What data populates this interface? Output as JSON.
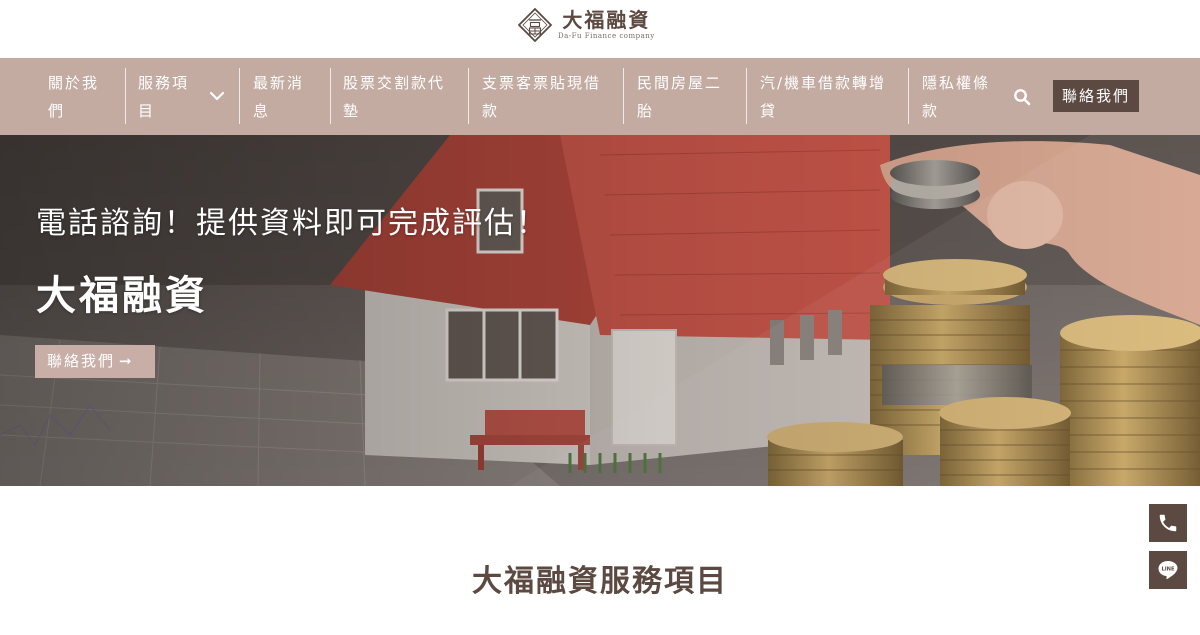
{
  "logo": {
    "name": "大福融資",
    "subtitle": "Da-Fu Finance company"
  },
  "nav": {
    "items": [
      {
        "label_line1": "關於我",
        "label_line2": "們"
      },
      {
        "label_line1": "服務項",
        "label_line2": "目"
      },
      {
        "label_line1": "最新消",
        "label_line2": "息"
      },
      {
        "label_line1": "股票交割款代",
        "label_line2": "墊"
      },
      {
        "label_line1": "支票客票貼現借",
        "label_line2": "款"
      },
      {
        "label_line1": "民間房屋二",
        "label_line2": "胎"
      },
      {
        "label_line1": "汽/機車借款轉增",
        "label_line2": "貸"
      },
      {
        "label_line1": "隱私權條",
        "label_line2": "款"
      }
    ],
    "contact_label": "聯絡我們",
    "search_icon": "search-icon",
    "dropdown_icon": "chevron-down-icon"
  },
  "hero": {
    "subtitle": "電話諮詢！提供資料即可完成評估！",
    "title": "大福融資",
    "button_label": "聯絡我們",
    "button_arrow": "➞"
  },
  "section": {
    "title": "大福融資服務項目"
  },
  "float_buttons": {
    "phone_icon": "phone-icon",
    "line_icon": "line-chat-icon",
    "line_text": "LINE"
  },
  "colors": {
    "nav_bg": "#c3aba2",
    "brand_dark": "#5c4a42",
    "hero_button": "#c8aea6"
  }
}
